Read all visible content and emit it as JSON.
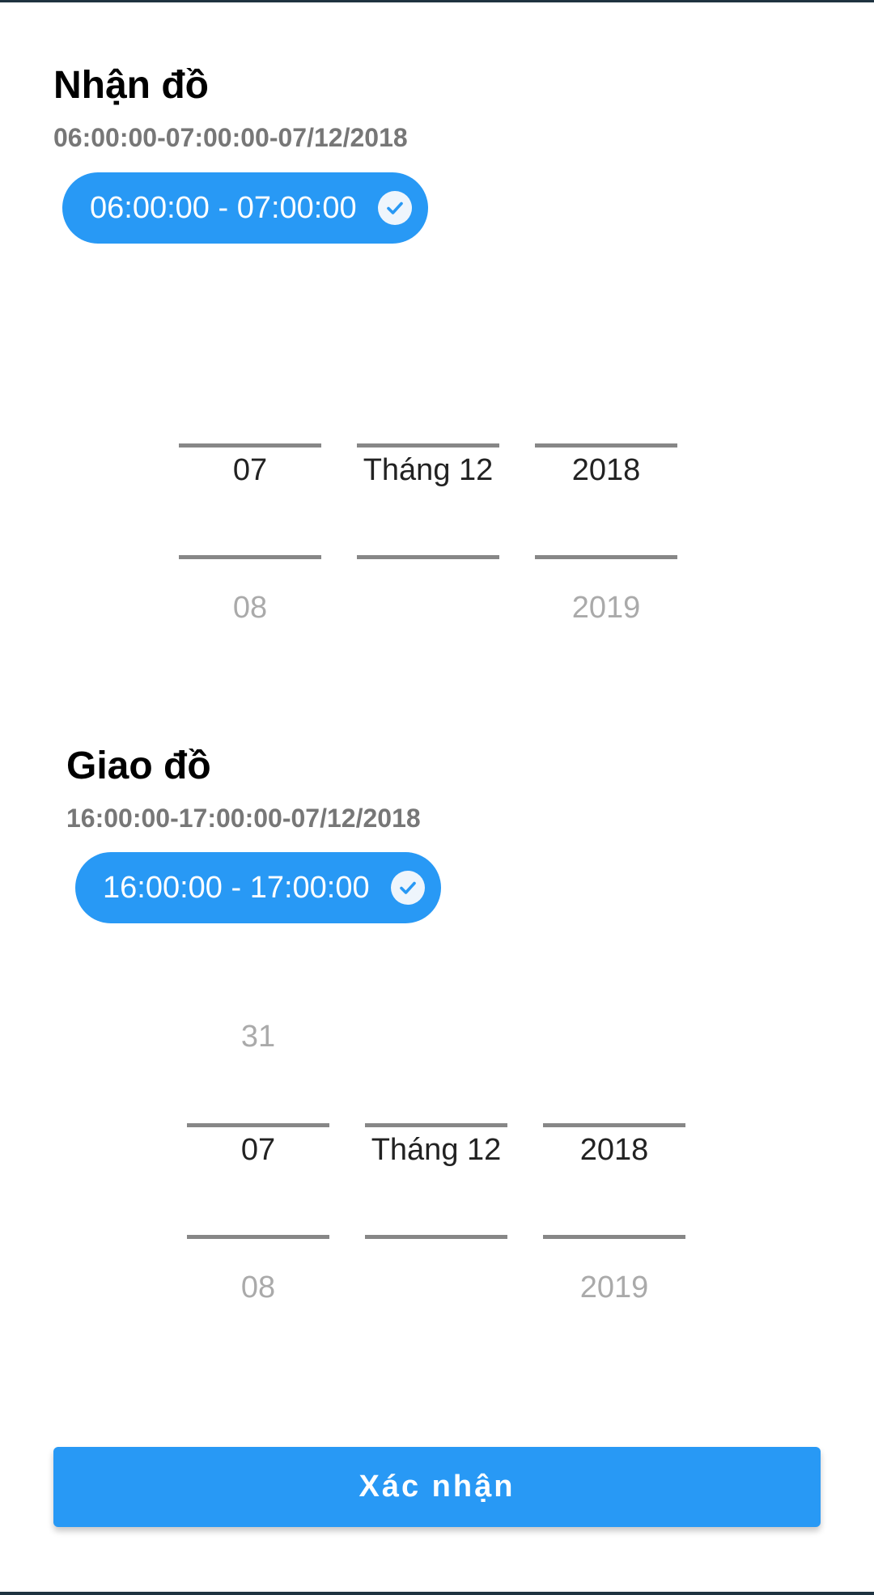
{
  "pickup": {
    "title": "Nhận đồ",
    "summary": "06:00:00-07:00:00-07/12/2018",
    "slot_label": "06:00:00 - 07:00:00",
    "picker": {
      "day": {
        "prev": "",
        "selected": "07",
        "next": "08"
      },
      "month": {
        "prev": "",
        "selected": "Tháng 12",
        "next": ""
      },
      "year": {
        "prev": "",
        "selected": "2018",
        "next": "2019"
      }
    }
  },
  "delivery": {
    "title": "Giao đồ",
    "summary": "16:00:00-17:00:00-07/12/2018",
    "slot_label": "16:00:00 - 17:00:00",
    "picker": {
      "day": {
        "prev": "31",
        "selected": "07",
        "next": "08"
      },
      "month": {
        "prev": "",
        "selected": "Tháng 12",
        "next": ""
      },
      "year": {
        "prev": "",
        "selected": "2018",
        "next": "2019"
      }
    }
  },
  "confirm_label": "Xác nhận",
  "colors": {
    "accent": "#2899f5",
    "divider": "#878787",
    "muted_text": "#777777",
    "faded_text": "#aaaaaa"
  },
  "icons": {
    "slot_selected": "check-circle-icon"
  }
}
